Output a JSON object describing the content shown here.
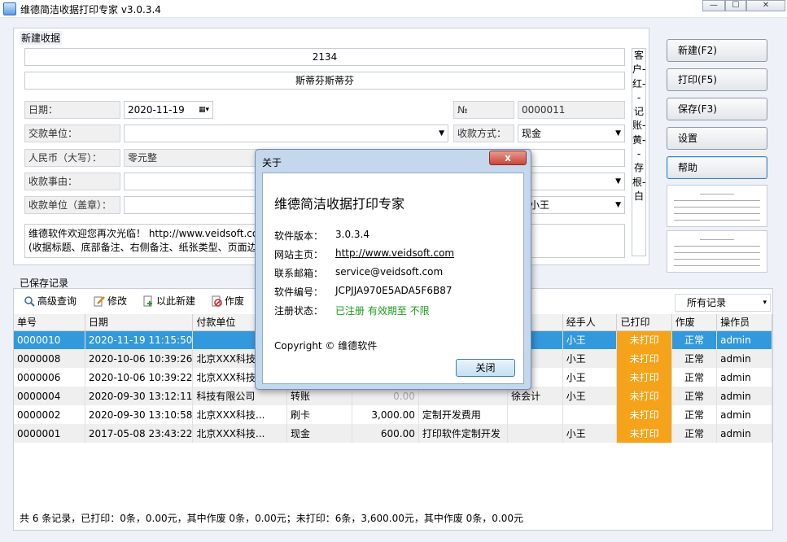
{
  "window": {
    "title": "维德简洁收据打印专家   v3.0.3.4",
    "min": "—",
    "max": "☐",
    "close": "✕"
  },
  "new_receipt": {
    "group_label": "新建收据",
    "customer_name": "2134",
    "subtitle": "斯蒂芬斯蒂芬",
    "date_label": "日期：",
    "date_value": "2020-11-19",
    "no_label": "№",
    "no_value": "0000011",
    "payer_label": "交款单位：",
    "payer_value": "",
    "method_label": "收款方式：",
    "method_value": "现金",
    "rmb_label": "人民币（大写）：",
    "rmb_value": "零元整",
    "reason_label": "收款事由：",
    "reason_value": "",
    "receiver_label": "收款单位（盖章）：",
    "handler_value": "小王",
    "memo_line1": "维德软件欢迎您再次光临！ http://www.veidsoft.co",
    "memo_line2": "(收据标题、底部备注、右侧备注、纸张类型、页面边",
    "vertical_note": "客户-红--记账-黄--存根-白"
  },
  "actions": {
    "new": "新建(F2)",
    "print": "打印(F5)",
    "save": "保存(F3)",
    "settings": "设置",
    "help": "帮助"
  },
  "records": {
    "label": "已保存记录",
    "toolbar": {
      "search": "高级查询",
      "edit": "修改",
      "new_from": "以此新建",
      "void": "作废"
    },
    "filter": "所有记录",
    "columns": [
      "单号",
      "日期",
      "付款单位",
      "",
      "",
      "",
      "",
      "经手人",
      "已打印",
      "作废",
      "操作员"
    ],
    "rows": [
      {
        "id": "0000010",
        "date": "2020-11-19 11:15:50",
        "payer": "",
        "method": "",
        "amount": "",
        "reason": "",
        "accountant": "",
        "handler": "小王",
        "printed": "未打印",
        "void": "正常",
        "operator": "admin",
        "state": "sel"
      },
      {
        "id": "0000008",
        "date": "2020-10-06 10:39:26",
        "payer": "北京XXX科技",
        "method": "",
        "amount": "",
        "reason": "",
        "accountant": "",
        "handler": "小王",
        "printed": "未打印",
        "void": "正常",
        "operator": "admin",
        "state": "alt"
      },
      {
        "id": "0000006",
        "date": "2020-10-06 10:39:22",
        "payer": "北京XXX科技",
        "method": "",
        "amount": "",
        "reason": "",
        "accountant": "",
        "handler": "小王",
        "printed": "未打印",
        "void": "正常",
        "operator": "admin",
        "state": ""
      },
      {
        "id": "0000004",
        "date": "2020-09-30 13:12:11",
        "payer": "科技有限公司",
        "method": "转账",
        "amount": "0.00",
        "reason": "",
        "accountant": "徐会计",
        "handler": "小王",
        "printed": "未打印",
        "void": "正常",
        "operator": "admin",
        "state": "alt"
      },
      {
        "id": "0000002",
        "date": "2020-09-30 13:10:58",
        "payer": "北京XXX科技...",
        "method": "刷卡",
        "amount": "3,000.00",
        "reason": "定制开发费用",
        "accountant": "",
        "handler": "",
        "printed": "未打印",
        "void": "正常",
        "operator": "admin",
        "state": ""
      },
      {
        "id": "0000001",
        "date": "2017-05-08 23:43:22",
        "payer": "北京XXX科技...",
        "method": "现金",
        "amount": "600.00",
        "reason": "打印软件定制开发",
        "accountant": "",
        "handler": "小王",
        "printed": "未打印",
        "void": "正常",
        "operator": "admin",
        "state": "alt"
      }
    ],
    "status": "共 6 条记录，已打印：0条，0.00元，其中作废  0条，0.00元；未打印：6条，3,600.00元，其中作废 0条，0.00元"
  },
  "about_dialog": {
    "title": "关于",
    "close_x": "x",
    "app_name": "维德简洁收据打印专家",
    "version_label": "软件版本：",
    "version": "3.0.3.4",
    "homepage_label": "网站主页：",
    "homepage": "http://www.veidsoft.com",
    "email_label": "联系邮箱：",
    "email": "service@veidsoft.com",
    "serial_label": "软件编号：",
    "serial": "JCPJJA970E5ADA5F6B87",
    "reg_label": "注册状态：",
    "reg": "已注册 有效期至 不限",
    "copyright": "Copyright © 维德软件",
    "close_button": "关闭"
  },
  "colors": {
    "selected_row": "#3399dd",
    "printed_flag": "#f5a31a",
    "registered": "#1c9c1c"
  }
}
